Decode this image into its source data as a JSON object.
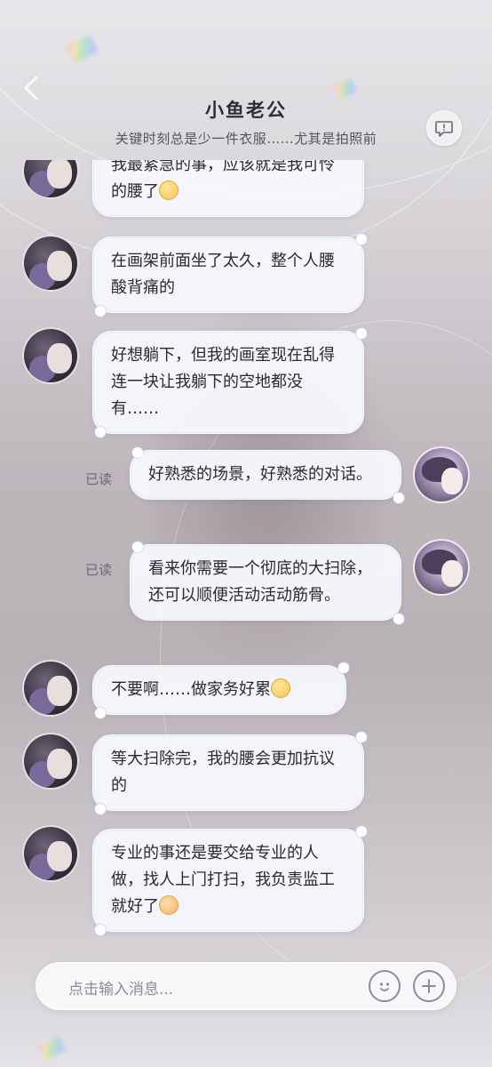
{
  "header": {
    "title": "小鱼老公",
    "subtitle": "关键时刻总是少一件衣服……尤其是拍照前"
  },
  "messages": [
    {
      "side": "left",
      "text": "我最紧急的事，应该就是我可怜的腰了",
      "emoji": "sad-face"
    },
    {
      "side": "left",
      "text": "在画架前面坐了太久，整个人腰酸背痛的"
    },
    {
      "side": "left",
      "text": "好想躺下，但我的画室现在乱得连一块让我躺下的空地都没有……"
    },
    {
      "side": "right",
      "status": "已读",
      "text": "好熟悉的场景，好熟悉的对话。"
    },
    {
      "side": "right",
      "status": "已读",
      "text": "看来你需要一个彻底的大扫除，还可以顺便活动活动筋骨。"
    },
    {
      "side": "left",
      "text": "不要啊……做家务好累",
      "emoji": "tired-face"
    },
    {
      "side": "left",
      "text": "等大扫除完，我的腰会更加抗议的"
    },
    {
      "side": "left",
      "text": "专业的事还是要交给专业的人做，找人上门打扫，我负责监工就好了",
      "emoji": "cat-face"
    }
  ],
  "input": {
    "placeholder": "点击输入消息..."
  },
  "icons": {
    "back": "back-icon",
    "profile": "chat-profile-icon",
    "emoji": "emoji-icon",
    "add": "plus-icon"
  },
  "colors": {
    "bubble": "#f6f7fd",
    "text": "#2a2a33",
    "read_status": "#6c6a72"
  }
}
